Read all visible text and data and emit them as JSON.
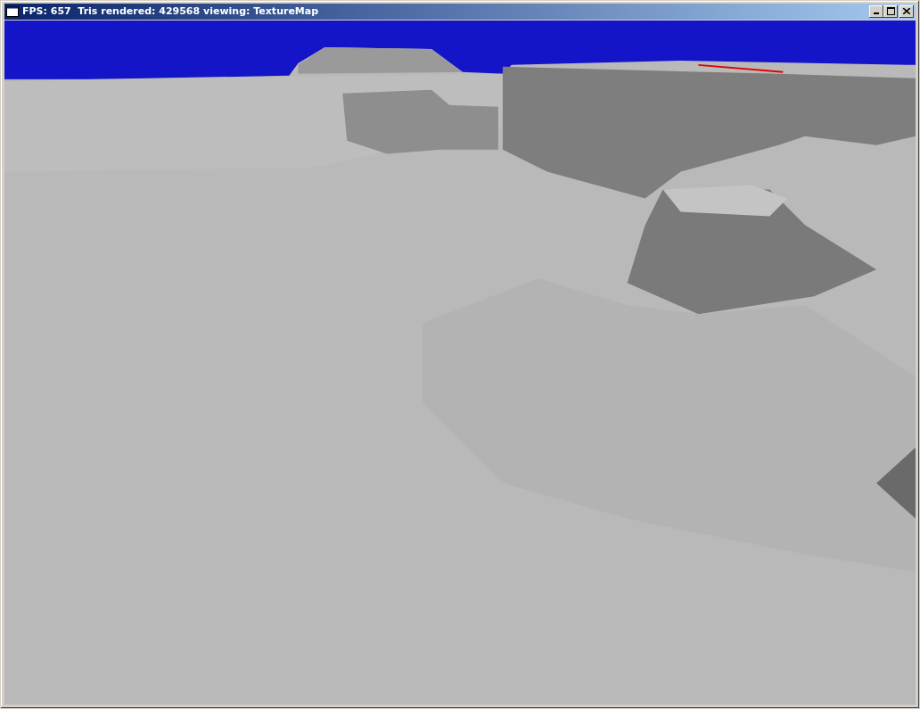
{
  "window": {
    "title": "FPS: 657  Tris rendered: 429568 viewing: TextureMap"
  }
}
